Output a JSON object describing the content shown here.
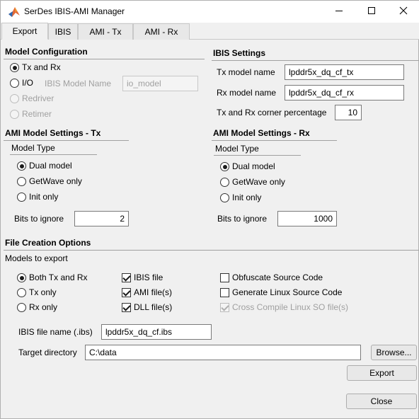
{
  "window": {
    "title": "SerDes IBIS-AMI Manager",
    "app_icon": "matlab-logo-icon",
    "minimize_icon": "minimize-icon",
    "maximize_icon": "maximize-icon",
    "close_icon": "close-icon"
  },
  "tabs": [
    "Export",
    "IBIS",
    "AMI - Tx",
    "AMI - Rx"
  ],
  "model_config": {
    "title": "Model Configuration",
    "tx_and_rx": "Tx and Rx",
    "io": "I/O",
    "ibis_model_name_label": "IBIS Model Name",
    "ibis_model_name_value": "io_model",
    "redriver": "Redriver",
    "retimer": "Retimer"
  },
  "ibis_settings": {
    "title": "IBIS Settings",
    "tx_model_name_label": "Tx model name",
    "tx_model_name_value": "lpddr5x_dq_cf_tx",
    "rx_model_name_label": "Rx model name",
    "rx_model_name_value": "lpddr5x_dq_cf_rx",
    "corner_label": "Tx and Rx corner percentage",
    "corner_value": "10"
  },
  "ami_tx": {
    "title": "AMI Model Settings - Tx",
    "model_type_label": "Model Type",
    "dual": "Dual model",
    "getwave": "GetWave only",
    "init": "Init only",
    "bits_label": "Bits to ignore",
    "bits_value": "2"
  },
  "ami_rx": {
    "title": "AMI Model Settings - Rx",
    "model_type_label": "Model Type",
    "dual": "Dual model",
    "getwave": "GetWave only",
    "init": "Init only",
    "bits_label": "Bits to ignore",
    "bits_value": "1000"
  },
  "file_creation": {
    "title": "File Creation Options",
    "models_to_export_label": "Models to export",
    "both": "Both Tx and Rx",
    "tx_only": "Tx only",
    "rx_only": "Rx only",
    "ibis_file": "IBIS file",
    "ami_files": "AMI file(s)",
    "dll_files": "DLL file(s)",
    "obfuscate": "Obfuscate Source Code",
    "gen_linux": "Generate Linux Source Code",
    "cross_compile": "Cross Compile Linux SO file(s)",
    "ibis_file_name_label": "IBIS file name (.ibs)",
    "ibis_file_name_value": "lpddr5x_dq_cf.ibs",
    "target_dir_label": "Target directory",
    "target_dir_value": "C:\\data",
    "browse": "Browse...",
    "export": "Export"
  },
  "footer": {
    "close": "Close"
  }
}
